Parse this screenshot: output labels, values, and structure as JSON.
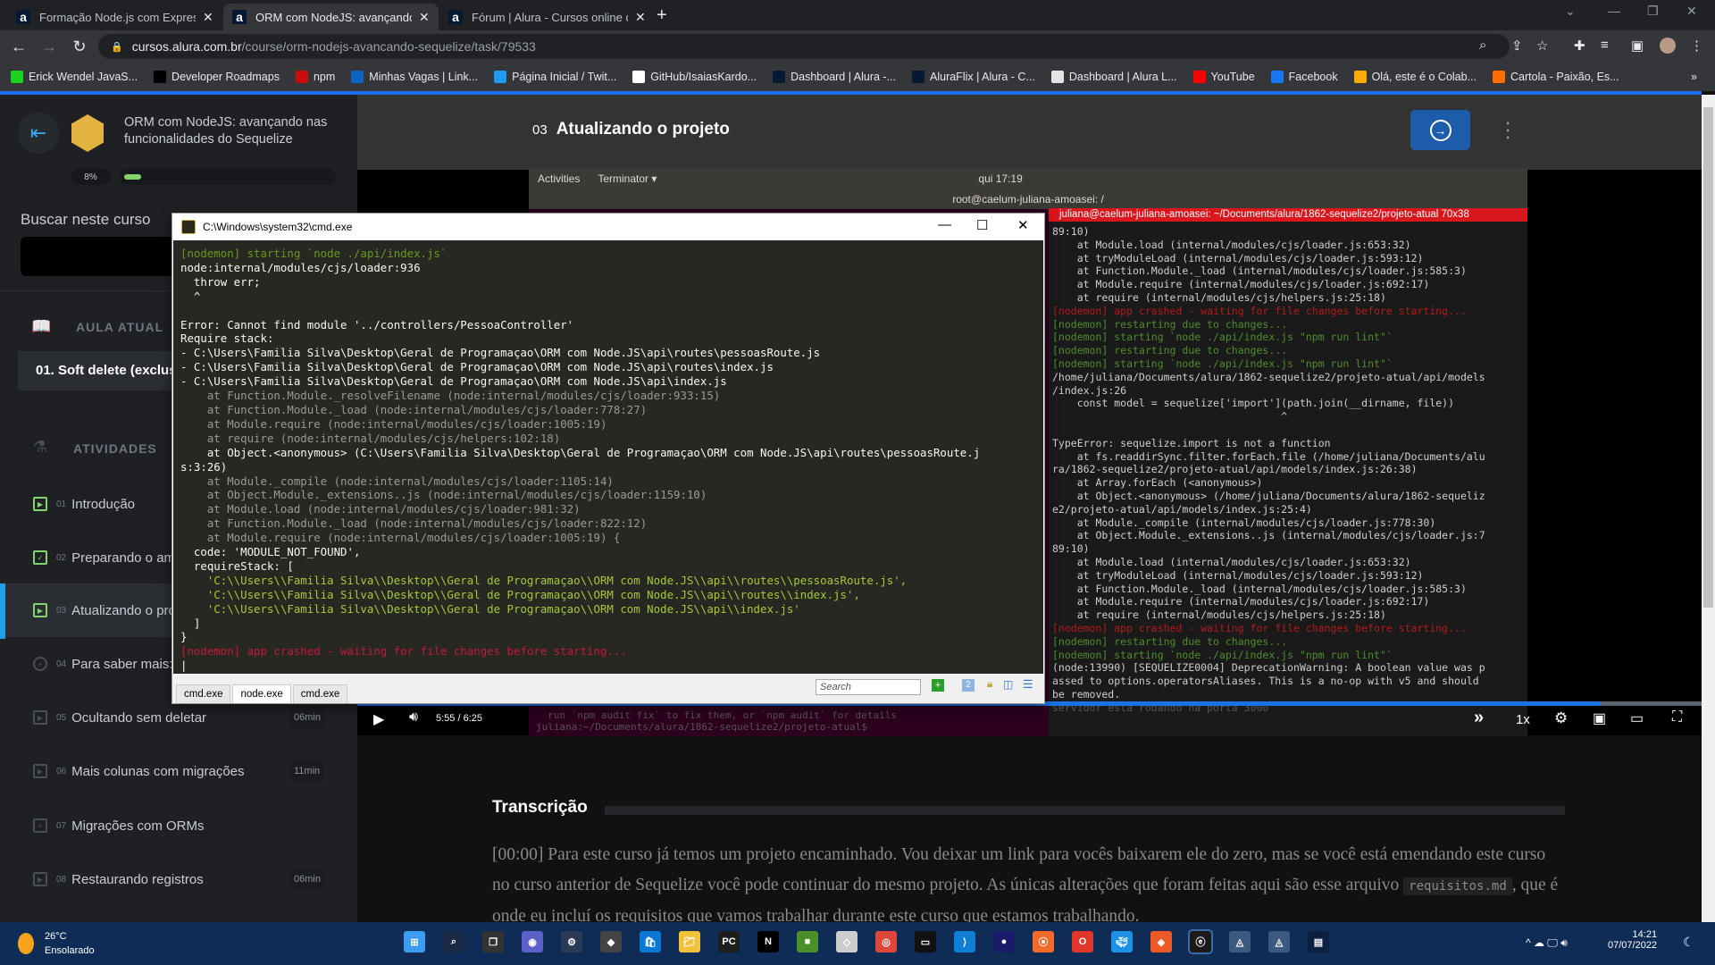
{
  "browser": {
    "tabs": [
      {
        "title": "Formação Node.js com Express |",
        "favicon": "alura-icon",
        "active": false
      },
      {
        "title": "ORM com NodeJS: avançando na",
        "favicon": "alura-icon",
        "active": true
      },
      {
        "title": "Fórum | Alura - Cursos online de",
        "favicon": "alura-icon",
        "active": false
      }
    ],
    "new_tab": "+",
    "url_host": "cursos.alura.com.br",
    "url_path": "/course/orm-nodejs-avancando-sequelize/task/79533",
    "bookmarks": [
      {
        "label": "Erick Wendel JavaS...",
        "color": "#1fd21f"
      },
      {
        "label": "Developer Roadmaps",
        "color": "#000000"
      },
      {
        "label": "npm",
        "color": "#cb0c0c"
      },
      {
        "label": "Minhas Vagas | Link...",
        "color": "#0a66c2"
      },
      {
        "label": "Página Inicial / Twit...",
        "color": "#1d9bf0"
      },
      {
        "label": "GitHub/IsaiasKardo...",
        "color": "#ffffff"
      },
      {
        "label": "Dashboard | Alura -...",
        "color": "#051933"
      },
      {
        "label": "AluraFlix | Alura - C...",
        "color": "#051933"
      },
      {
        "label": "Dashboard | Alura L...",
        "color": "#e4e4e4"
      },
      {
        "label": "YouTube",
        "color": "#ff0000"
      },
      {
        "label": "Facebook",
        "color": "#1877f2"
      },
      {
        "label": "Olá, este é o Colab...",
        "color": "#f9ab00"
      },
      {
        "label": "Cartola - Paixão, Es...",
        "color": "#ff6d00"
      }
    ],
    "bookmarks_overflow": "»"
  },
  "sidebar": {
    "course_title": "ORM com NodeJS: avançando nas funcionalidades do Sequelize",
    "progress_label": "8%",
    "progress": 0.08,
    "search_label": "Buscar neste curso",
    "current_section_label": "AULA ATUAL",
    "current_lesson": "01. Soft delete (exclusão suave)",
    "activities_label": "ATIVIDADES",
    "lessons": [
      {
        "num": "01",
        "title": "Introdução",
        "duration": "",
        "icon": "video-icon",
        "done": true
      },
      {
        "num": "02",
        "title": "Preparando o ambiente",
        "duration": "",
        "icon": "checklist-icon",
        "done": true
      },
      {
        "num": "03",
        "title": "Atualizando o projeto",
        "duration": "",
        "icon": "video-icon",
        "done": true,
        "active": true
      },
      {
        "num": "04",
        "title": "Para saber mais: requisitos do projeto",
        "duration": "",
        "icon": "plus-icon",
        "done": false
      },
      {
        "num": "05",
        "title": "Ocultando sem deletar",
        "duration": "06min",
        "icon": "video-icon",
        "done": false
      },
      {
        "num": "06",
        "title": "Mais colunas com migrações",
        "duration": "11min",
        "icon": "video-icon",
        "done": false
      },
      {
        "num": "07",
        "title": "Migrações com ORMs",
        "duration": "",
        "icon": "list-icon",
        "done": false
      },
      {
        "num": "08",
        "title": "Restaurando registros",
        "duration": "06min",
        "icon": "video-icon",
        "done": false
      }
    ]
  },
  "header": {
    "lesson_number": "03",
    "lesson_title": "Atualizando o projeto",
    "next_icon": "arrow-right-circle-icon"
  },
  "video": {
    "ubuntu_bar": {
      "activities": "Activities",
      "app": "Terminator ▾",
      "clock": "qui 17:19"
    },
    "terminator_title": "root@caelum-juliana-amoasei: /",
    "right_term_header": "juliana@caelum-juliana-amoasei: ~/Documents/alura/1862-sequelize2/projeto-atual 70x38",
    "right_term_lines": [
      {
        "t": "89:10)",
        "c": ""
      },
      {
        "t": "    at Module.load (internal/modules/cjs/loader.js:653:32)",
        "c": ""
      },
      {
        "t": "    at tryModuleLoad (internal/modules/cjs/loader.js:593:12)",
        "c": ""
      },
      {
        "t": "    at Function.Module._load (internal/modules/cjs/loader.js:585:3)",
        "c": ""
      },
      {
        "t": "    at Module.require (internal/modules/cjs/loader.js:692:17)",
        "c": ""
      },
      {
        "t": "    at require (internal/modules/cjs/helpers.js:25:18)",
        "c": ""
      },
      {
        "t": "[nodemon] app crashed - waiting for file changes before starting...",
        "c": "r"
      },
      {
        "t": "[nodemon] restarting due to changes...",
        "c": "g"
      },
      {
        "t": "[nodemon] starting `node ./api/index.js \"npm run lint\"`",
        "c": "g"
      },
      {
        "t": "[nodemon] restarting due to changes...",
        "c": "g"
      },
      {
        "t": "[nodemon] starting `node ./api/index.js \"npm run lint\"`",
        "c": "g"
      },
      {
        "t": "/home/juliana/Documents/alura/1862-sequelize2/projeto-atual/api/models",
        "c": ""
      },
      {
        "t": "/index.js:26",
        "c": ""
      },
      {
        "t": "    const model = sequelize['import'](path.join(__dirname, file))",
        "c": ""
      },
      {
        "t": "                                     ^",
        "c": ""
      },
      {
        "t": "",
        "c": ""
      },
      {
        "t": "TypeError: sequelize.import is not a function",
        "c": ""
      },
      {
        "t": "    at fs.readdirSync.filter.forEach.file (/home/juliana/Documents/alu",
        "c": ""
      },
      {
        "t": "ra/1862-sequelize2/projeto-atual/api/models/index.js:26:38)",
        "c": ""
      },
      {
        "t": "    at Array.forEach (<anonymous>)",
        "c": ""
      },
      {
        "t": "    at Object.<anonymous> (/home/juliana/Documents/alura/1862-sequeliz",
        "c": ""
      },
      {
        "t": "e2/projeto-atual/api/models/index.js:25:4)",
        "c": ""
      },
      {
        "t": "    at Module._compile (internal/modules/cjs/loader.js:778:30)",
        "c": ""
      },
      {
        "t": "    at Object.Module._extensions..js (internal/modules/cjs/loader.js:7",
        "c": ""
      },
      {
        "t": "89:10)",
        "c": ""
      },
      {
        "t": "    at Module.load (internal/modules/cjs/loader.js:653:32)",
        "c": ""
      },
      {
        "t": "    at tryModuleLoad (internal/modules/cjs/loader.js:593:12)",
        "c": ""
      },
      {
        "t": "    at Function.Module._load (internal/modules/cjs/loader.js:585:3)",
        "c": ""
      },
      {
        "t": "    at Module.require (internal/modules/cjs/loader.js:692:17)",
        "c": ""
      },
      {
        "t": "    at require (internal/modules/cjs/helpers.js:25:18)",
        "c": ""
      },
      {
        "t": "[nodemon] app crashed - waiting for file changes before starting...",
        "c": "r"
      },
      {
        "t": "[nodemon] restarting due to changes...",
        "c": "g"
      },
      {
        "t": "[nodemon] starting `node ./api/index.js \"npm run lint\"`",
        "c": "g"
      },
      {
        "t": "(node:13990) [SEQUELIZE0004] DeprecationWarning: A boolean value was p",
        "c": ""
      },
      {
        "t": "assed to options.operatorsAliases. This is a no-op with v5 and should",
        "c": ""
      },
      {
        "t": "be removed.",
        "c": ""
      },
      {
        "t": "servidor está rodando na porta 3000",
        "c": ""
      }
    ],
    "left_term_bottom": [
      "  run `npm audit fix` to fix them, or `npm audit` for details",
      "juliana:~/Documents/alura/1862-sequelize2/projeto-atual$"
    ],
    "current_time": "5:55",
    "duration": "6:25",
    "progress": 0.925,
    "speed": "1x"
  },
  "cmd_window": {
    "title": "C:\\Windows\\system32\\cmd.exe",
    "lines": [
      {
        "t": "[nodemon] starting `node ./api/index.js`",
        "c": "cg"
      },
      {
        "t": "node:internal/modules/cjs/loader:936",
        "c": ""
      },
      {
        "t": "  throw err;",
        "c": ""
      },
      {
        "t": "  ^",
        "c": ""
      },
      {
        "t": "",
        "c": ""
      },
      {
        "t": "Error: Cannot find module '../controllers/PessoaController'",
        "c": ""
      },
      {
        "t": "Require stack:",
        "c": ""
      },
      {
        "t": "- C:\\Users\\Familia Silva\\Desktop\\Geral de Programaçao\\ORM com Node.JS\\api\\routes\\pessoasRoute.js",
        "c": ""
      },
      {
        "t": "- C:\\Users\\Familia Silva\\Desktop\\Geral de Programaçao\\ORM com Node.JS\\api\\routes\\index.js",
        "c": ""
      },
      {
        "t": "- C:\\Users\\Familia Silva\\Desktop\\Geral de Programaçao\\ORM com Node.JS\\api\\index.js",
        "c": ""
      },
      {
        "t": "    at Function.Module._resolveFilename (node:internal/modules/cjs/loader:933:15)",
        "c": "cgr"
      },
      {
        "t": "    at Function.Module._load (node:internal/modules/cjs/loader:778:27)",
        "c": "cgr"
      },
      {
        "t": "    at Module.require (node:internal/modules/cjs/loader:1005:19)",
        "c": "cgr"
      },
      {
        "t": "    at require (node:internal/modules/cjs/helpers:102:18)",
        "c": "cgr"
      },
      {
        "t": "    at Object.<anonymous> (C:\\Users\\Familia Silva\\Desktop\\Geral de Programaçao\\ORM com Node.JS\\api\\routes\\pessoasRoute.j",
        "c": ""
      },
      {
        "t": "s:3:26)",
        "c": ""
      },
      {
        "t": "    at Module._compile (node:internal/modules/cjs/loader:1105:14)",
        "c": "cgr"
      },
      {
        "t": "    at Object.Module._extensions..js (node:internal/modules/cjs/loader:1159:10)",
        "c": "cgr"
      },
      {
        "t": "    at Module.load (node:internal/modules/cjs/loader:981:32)",
        "c": "cgr"
      },
      {
        "t": "    at Function.Module._load (node:internal/modules/cjs/loader:822:12)",
        "c": "cgr"
      },
      {
        "t": "    at Module.require (node:internal/modules/cjs/loader:1005:19) {",
        "c": "cgr"
      },
      {
        "t": "  code: 'MODULE_NOT_FOUND',",
        "c": ""
      },
      {
        "t": "  requireStack: [",
        "c": ""
      },
      {
        "t": "    'C:\\\\Users\\\\Familia Silva\\\\Desktop\\\\Geral de Programaçao\\\\ORM com Node.JS\\\\api\\\\routes\\\\pessoasRoute.js',",
        "c": "cs"
      },
      {
        "t": "    'C:\\\\Users\\\\Familia Silva\\\\Desktop\\\\Geral de Programaçao\\\\ORM com Node.JS\\\\api\\\\routes\\\\index.js',",
        "c": "cs"
      },
      {
        "t": "    'C:\\\\Users\\\\Familia Silva\\\\Desktop\\\\Geral de Programaçao\\\\ORM com Node.JS\\\\api\\\\index.js'",
        "c": "cs"
      },
      {
        "t": "  ]",
        "c": ""
      },
      {
        "t": "}",
        "c": ""
      },
      {
        "t": "[nodemon] app crashed - waiting for file changes before starting...",
        "c": "cr"
      }
    ],
    "tabs": [
      "cmd.exe",
      "node.exe",
      "cmd.exe"
    ],
    "active_tab": 1,
    "search_placeholder": "Search"
  },
  "transcript": {
    "title": "Transcrição",
    "text_before": "[00:00] Para este curso já temos um projeto encaminhado. Vou deixar um link para vocês baixarem ele do zero, mas se você está emendando este curso no curso anterior de Sequelize você pode continuar do mesmo projeto. As únicas alterações que foram feitas aqui são esse arquivo ",
    "code": "requisitos.md",
    "text_after": ", que é onde eu incluí os requisitos que vamos trabalhar durante este curso que estamos trabalhando."
  },
  "taskbar": {
    "weather_temp": "26°C",
    "weather_desc": "Ensolarado",
    "time": "14:21",
    "date": "07/07/2022",
    "apps": [
      "start-icon",
      "search-icon",
      "task-view-icon",
      "teams-icon",
      "settings-icon",
      "unity-icon",
      "store-icon",
      "file-explorer-icon",
      "pycharm-icon",
      "netflix-icon",
      "minecraft-icon",
      "app-icon",
      "chrome-icon",
      "terminal-icon",
      "vscode-icon",
      "eclipse-icon",
      "postman-icon",
      "office-icon",
      "docker-icon",
      "git-icon",
      "conemu-icon",
      "mysql-workbench-icon",
      "mysql-workbench-2-icon",
      "mysql-shell-icon"
    ]
  }
}
